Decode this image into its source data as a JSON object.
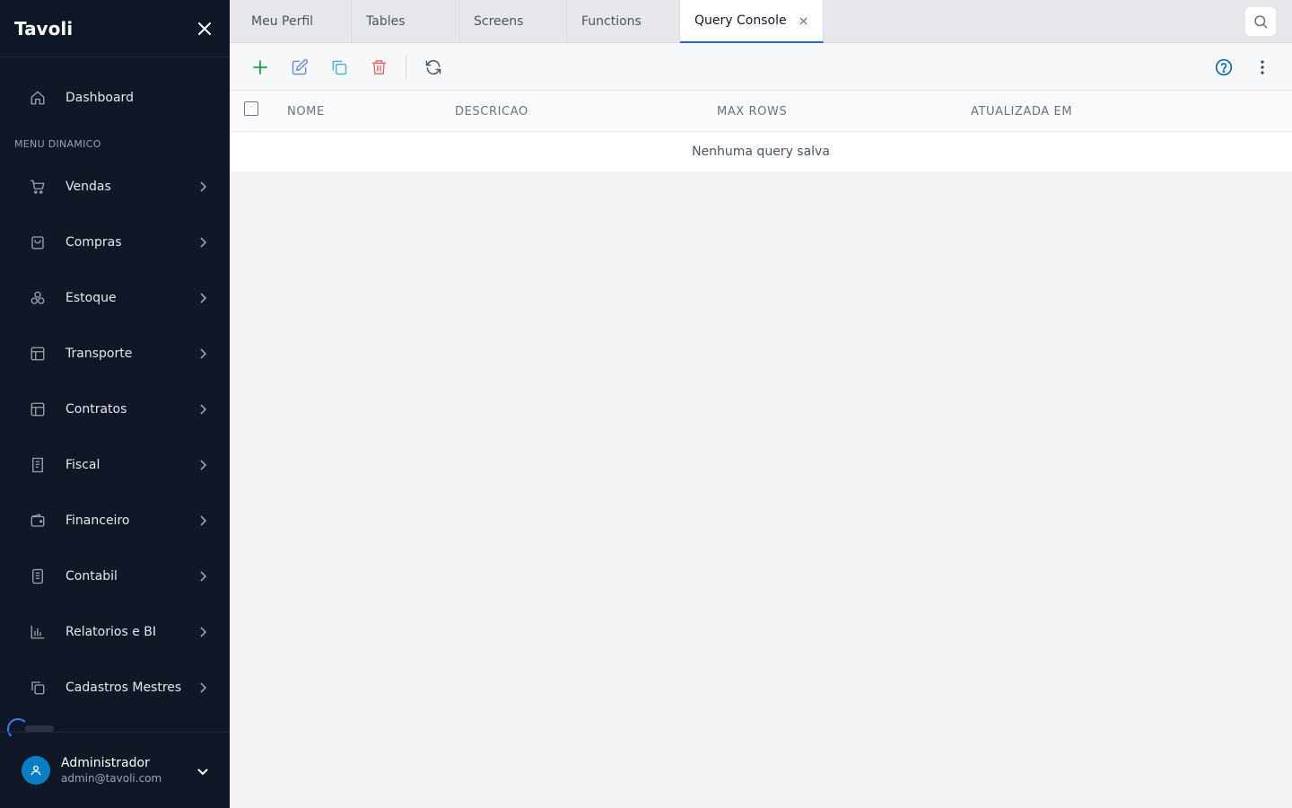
{
  "app": {
    "brand": "Tavoli"
  },
  "sidebar": {
    "dashboard": {
      "label": "Dashboard",
      "icon": "home-icon"
    },
    "section_label": "MENU DINAMICO",
    "items": [
      {
        "label": "Vendas",
        "icon": "cart-icon"
      },
      {
        "label": "Compras",
        "icon": "shopping-bag-icon"
      },
      {
        "label": "Estoque",
        "icon": "boxes-icon"
      },
      {
        "label": "Transporte",
        "icon": "layout-icon"
      },
      {
        "label": "Contratos",
        "icon": "layout-icon"
      },
      {
        "label": "Fiscal",
        "icon": "receipt-icon"
      },
      {
        "label": "Financeiro",
        "icon": "wallet-icon"
      },
      {
        "label": "Contabil",
        "icon": "ledger-icon"
      },
      {
        "label": "Relatorios e BI",
        "icon": "bar-chart-icon"
      },
      {
        "label": "Cadastros Mestres",
        "icon": "copy-icon"
      }
    ],
    "user": {
      "name": "Administrador",
      "email": "admin@tavoli.com"
    }
  },
  "tabs": [
    {
      "label": "Meu Perfil"
    },
    {
      "label": "Tables"
    },
    {
      "label": "Screens"
    },
    {
      "label": "Functions"
    },
    {
      "label": "Query Console",
      "active": true
    }
  ],
  "toolbar": {
    "buttons": [
      "plus-icon",
      "edit-icon",
      "duplicate-icon",
      "trash-icon",
      "refresh-icon",
      "help-icon",
      "more-vertical-icon"
    ],
    "colors": {
      "add": "#16a34a",
      "edit": "#6b8fd6",
      "duplicate": "#4cb3d4",
      "delete": "#ef6b6b",
      "help": "#0a6fb8"
    }
  },
  "table": {
    "columns": [
      "NOME",
      "DESCRICAO",
      "MAX ROWS",
      "ATUALIZADA EM"
    ],
    "empty_message": "Nenhuma query salva"
  },
  "theme": {
    "sidebar_bg": "#101828",
    "accent": "#2563eb",
    "avatar": "#0a7ec2"
  }
}
